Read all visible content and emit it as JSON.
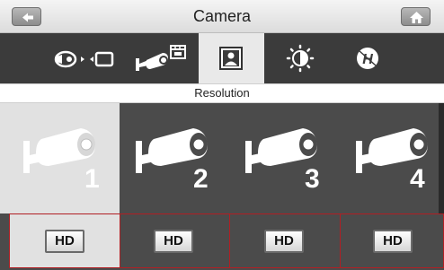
{
  "header": {
    "title": "Camera",
    "back_icon": "back-arrow-icon",
    "home_icon": "home-icon"
  },
  "toolbar": {
    "items": [
      {
        "name": "camera-to-screen-icon",
        "selected": false
      },
      {
        "name": "camera-record-icon",
        "selected": false
      },
      {
        "name": "portrait-icon",
        "selected": true
      },
      {
        "name": "brightness-icon",
        "selected": false
      },
      {
        "name": "flicker-hz-icon",
        "selected": false
      }
    ]
  },
  "section_label": "Resolution",
  "cameras": [
    {
      "number": "1",
      "selected": true
    },
    {
      "number": "2",
      "selected": false
    },
    {
      "number": "3",
      "selected": false
    },
    {
      "number": "4",
      "selected": false
    }
  ],
  "hd_buttons": [
    {
      "label": "HD"
    },
    {
      "label": "HD"
    },
    {
      "label": "HD"
    },
    {
      "label": "HD"
    }
  ],
  "colors": {
    "dark_bg": "#4b4b4b",
    "selected_bg": "#e1e1e1",
    "border_red": "#b11f24"
  }
}
